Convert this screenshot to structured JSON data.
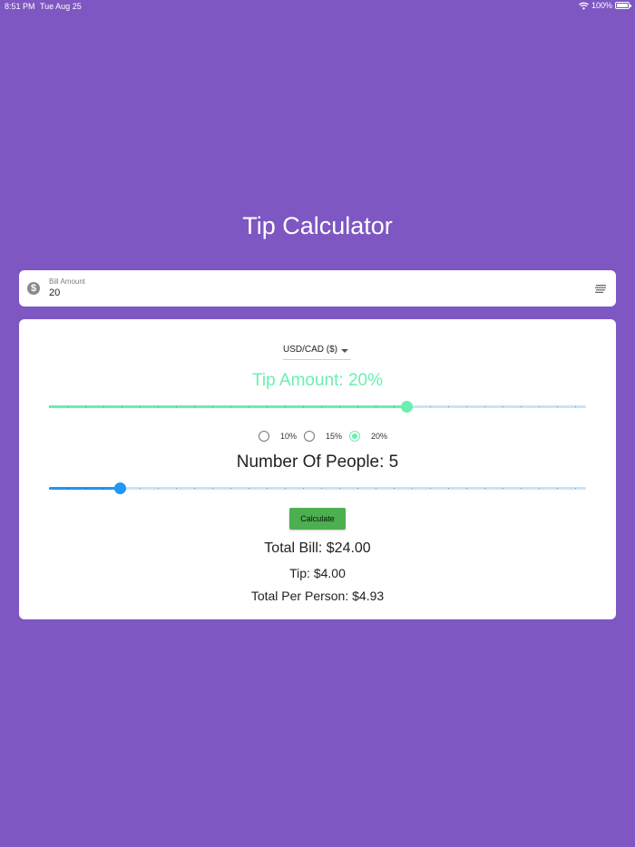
{
  "status_bar": {
    "time": "8:51 PM",
    "date": "Tue Aug 25",
    "battery": "100%"
  },
  "app": {
    "title": "Tip Calculator"
  },
  "bill": {
    "label": "Bill Amount",
    "value": "20"
  },
  "currency": {
    "selected": "USD/CAD ($)"
  },
  "tip": {
    "heading": "Tip Amount: 20%",
    "slider_fraction": 0.667,
    "options": [
      "10%",
      "15%",
      "20%"
    ],
    "selected_index": 2
  },
  "people": {
    "heading": "Number Of People: 5",
    "slider_fraction": 0.133
  },
  "actions": {
    "calculate_label": "Calculate"
  },
  "results": {
    "total_bill": "Total Bill: $24.00",
    "tip": "Tip: $4.00",
    "per_person": "Total Per Person: $4.93"
  },
  "colors": {
    "background": "#7e57c2",
    "tip_accent": "#69f0ae",
    "people_accent": "#2196f3",
    "rail_light": "#c9e3fb",
    "button": "#4caf50"
  },
  "icons": {
    "bill_leading": "dollar-circle-icon",
    "bill_trailing": "list-lines-icon",
    "wifi": "wifi-icon",
    "battery": "battery-icon"
  }
}
